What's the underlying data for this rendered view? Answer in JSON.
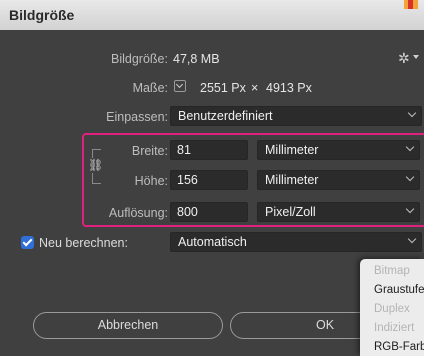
{
  "window": {
    "title": "Bildgröße"
  },
  "info": {
    "size_label": "Bildgröße:",
    "size_value": "47,8 MB",
    "dims_label": "Maße:",
    "dims_width": "2551 Px",
    "dims_times": "×",
    "dims_height": "4913 Px"
  },
  "fit": {
    "label": "Einpassen:",
    "value": "Benutzerdefiniert"
  },
  "width": {
    "label": "Breite:",
    "value": "81",
    "unit": "Millimeter"
  },
  "height": {
    "label": "Höhe:",
    "value": "156",
    "unit": "Millimeter"
  },
  "resolution": {
    "label": "Auflösung:",
    "value": "800",
    "unit": "Pixel/Zoll"
  },
  "resample": {
    "label": "Neu berechnen:",
    "checked": true,
    "value": "Automatisch"
  },
  "buttons": {
    "cancel": "Abbrechen",
    "ok": "OK"
  },
  "dropdown_menu": {
    "items": [
      {
        "label": "Bitmap",
        "enabled": false
      },
      {
        "label": "Graustufen",
        "enabled": true
      },
      {
        "label": "Duplex",
        "enabled": false
      },
      {
        "label": "Indiziert",
        "enabled": false
      },
      {
        "label": "RGB-Farbe",
        "enabled": true
      }
    ]
  },
  "colors": {
    "dialog_bg": "#404040",
    "highlight": "#e0217f",
    "checkbox": "#2f6fd6"
  }
}
